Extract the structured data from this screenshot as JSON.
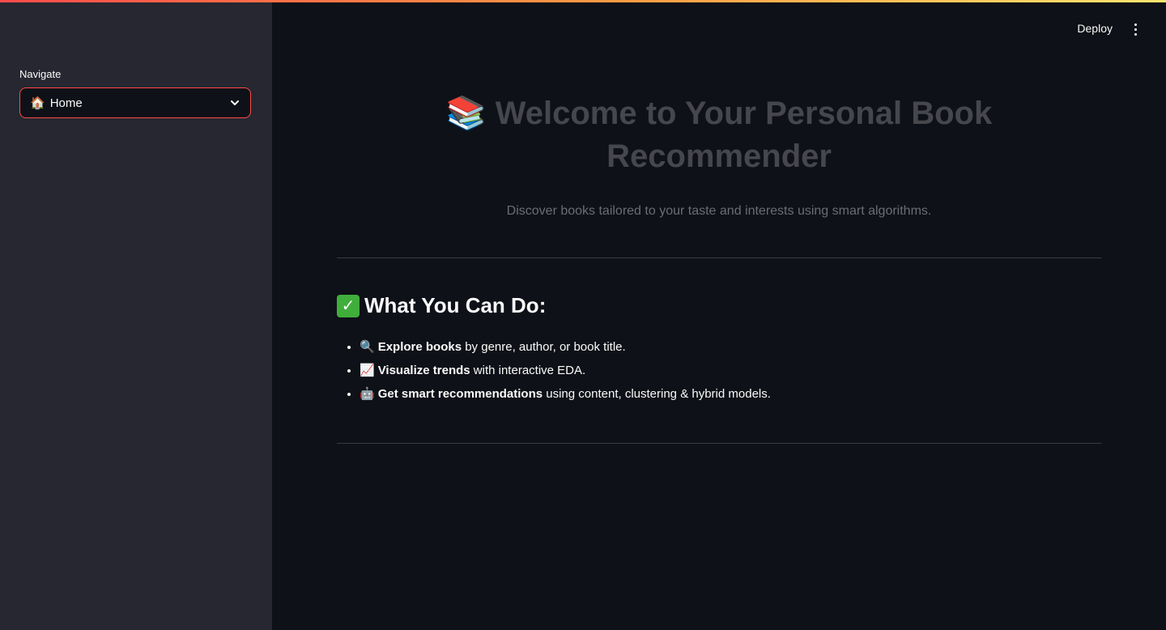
{
  "sidebar": {
    "nav_label": "Navigate",
    "select": {
      "icon": "🏠",
      "value": "Home"
    }
  },
  "header": {
    "deploy_label": "Deploy"
  },
  "hero": {
    "title": "📚 Welcome to Your Personal Book Recommender",
    "subtitle": "Discover books tailored to your taste and interests using smart algorithms."
  },
  "section": {
    "title": "What You Can Do:",
    "icon": "✓",
    "items": [
      {
        "emoji": "🔍",
        "bold": "Explore books",
        "rest": " by genre, author, or book title."
      },
      {
        "emoji": "📈",
        "bold": "Visualize trends",
        "rest": " with interactive EDA."
      },
      {
        "emoji": "🤖",
        "bold": "Get smart recommendations",
        "rest": " using content, clustering & hybrid models."
      }
    ]
  },
  "colors": {
    "accent": "#ff4b4b",
    "sidebar_bg": "#262730",
    "main_bg": "#0e1117",
    "check_green": "#3fae3b"
  }
}
